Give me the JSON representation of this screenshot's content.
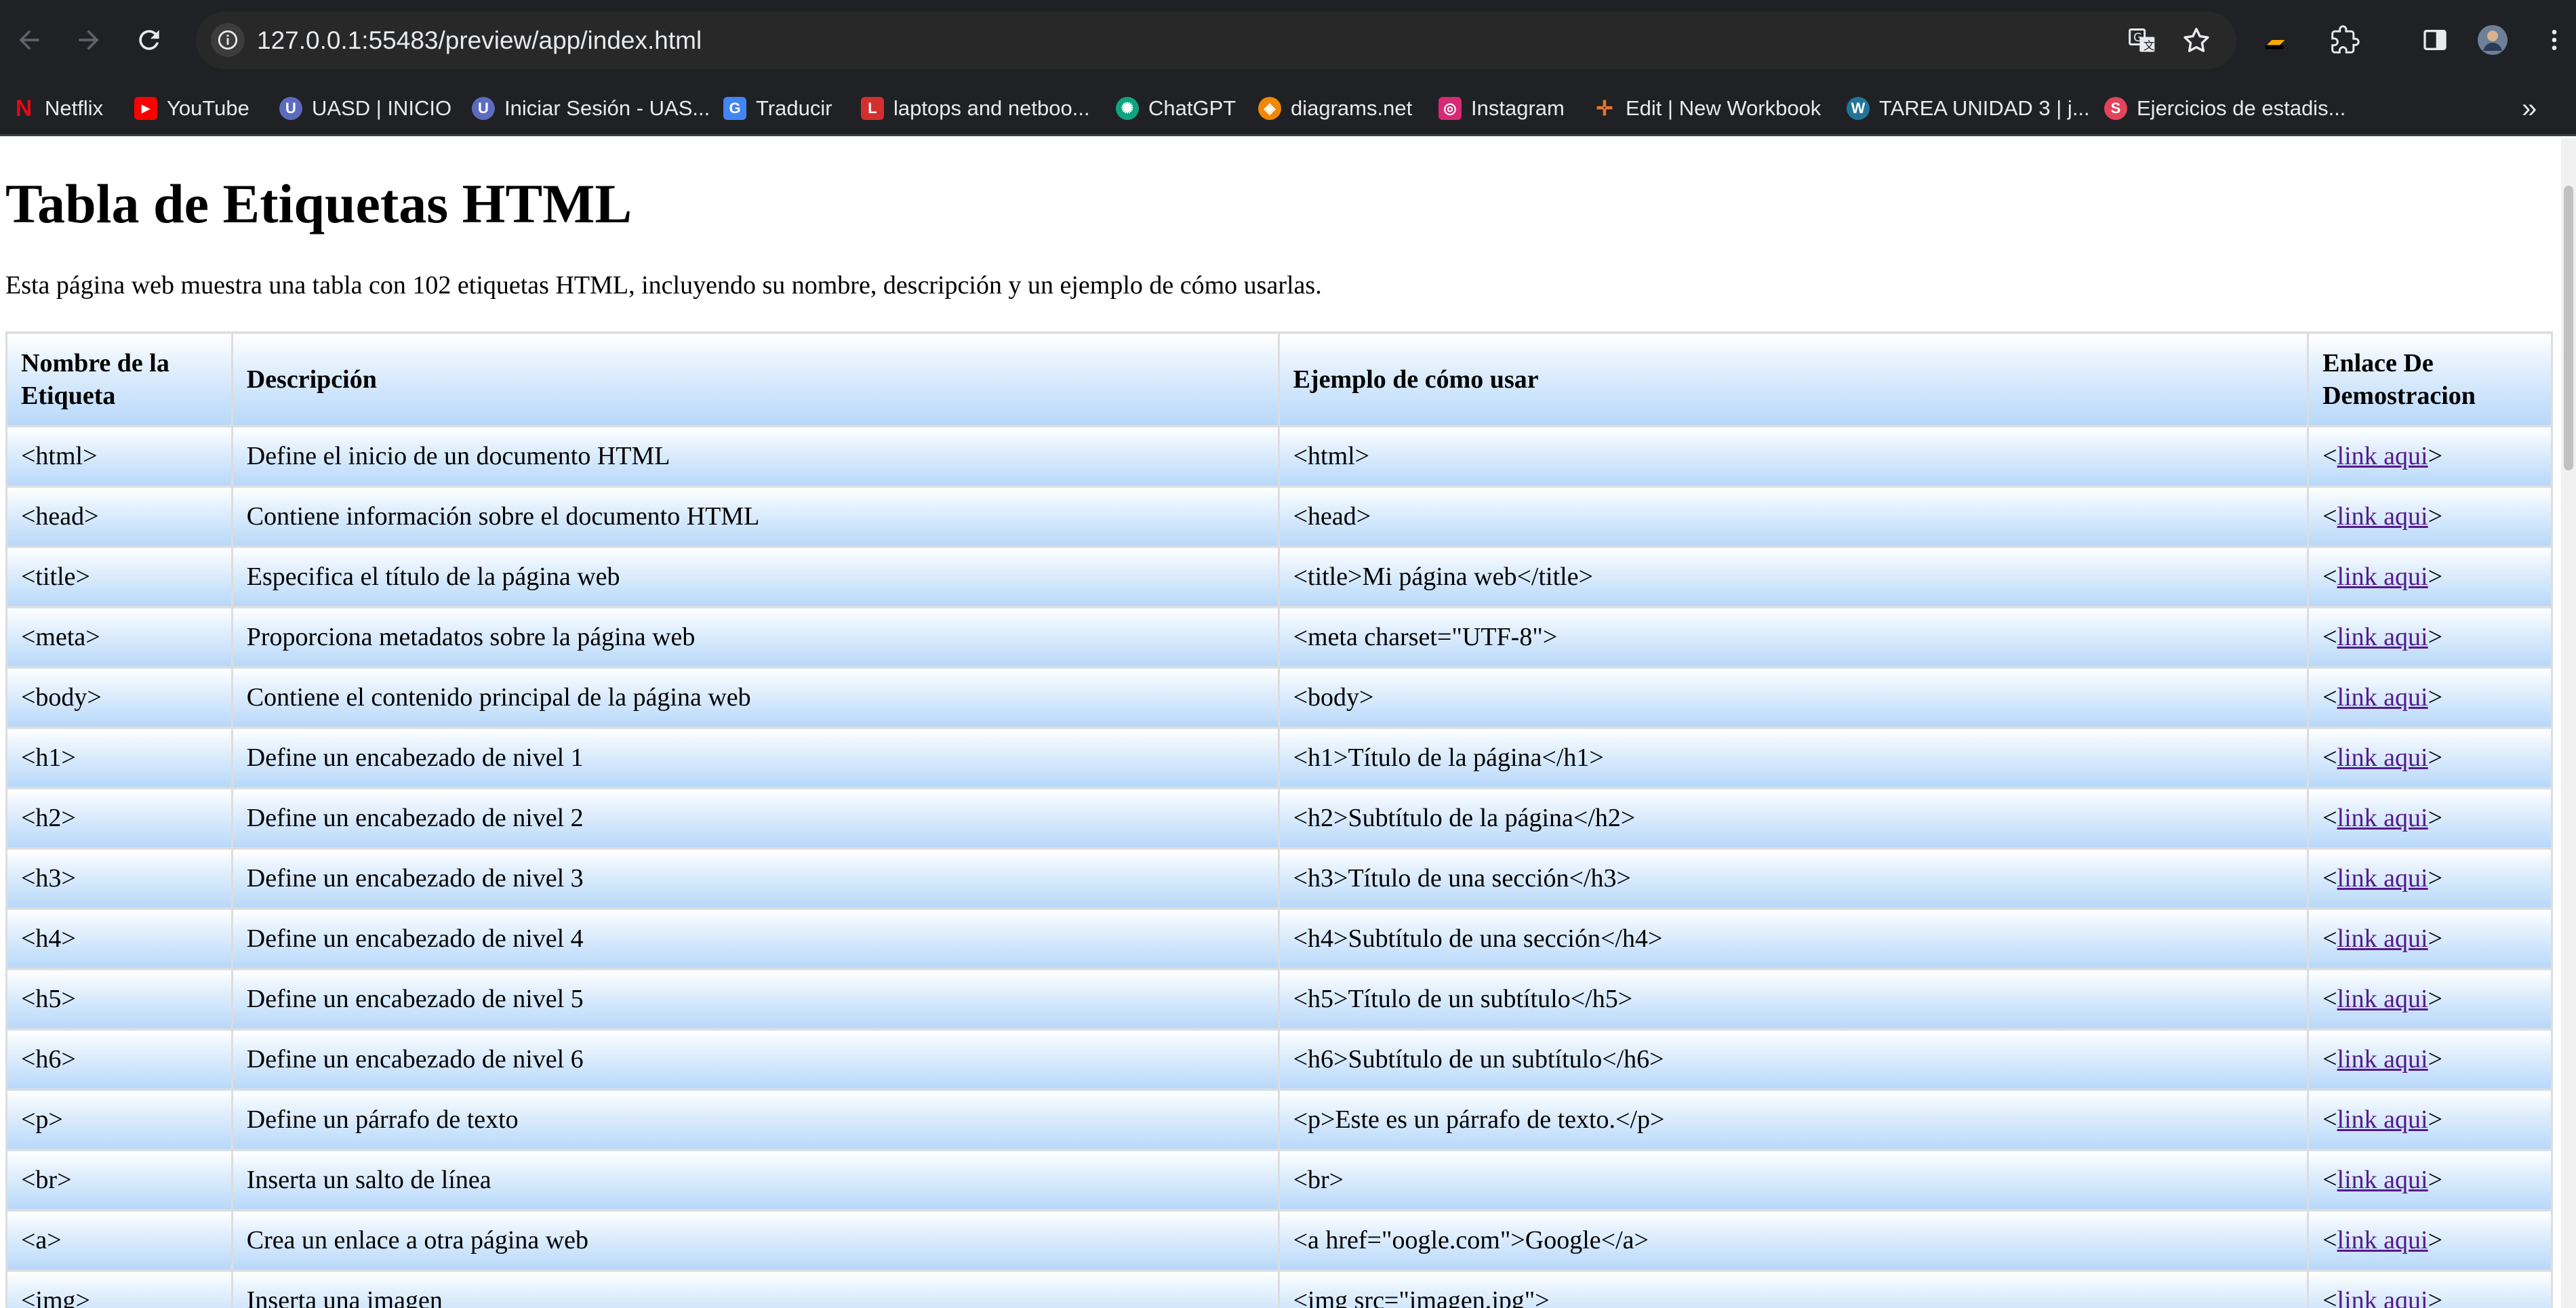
{
  "browser": {
    "url": "127.0.0.1:55483/preview/app/index.html",
    "bookmarks": [
      {
        "label": "Netflix",
        "icon": "netflix-icon",
        "color": "#e50914",
        "glyph": "N"
      },
      {
        "label": "YouTube",
        "icon": "youtube-icon",
        "color": "#ff0000",
        "glyph": "▶"
      },
      {
        "label": "UASD | INICIO",
        "icon": "uasd-icon",
        "color": "#5c6bc0",
        "glyph": "U"
      },
      {
        "label": "Iniciar Sesión - UAS...",
        "icon": "uasd-login-icon",
        "color": "#5c6bc0",
        "glyph": "U"
      },
      {
        "label": "Traducir",
        "icon": "translate-icon",
        "color": "#4285f4",
        "glyph": "G"
      },
      {
        "label": "laptops and netboo...",
        "icon": "laptops-icon",
        "color": "#d32f2f",
        "glyph": "L"
      },
      {
        "label": "ChatGPT",
        "icon": "chatgpt-icon",
        "color": "#10a37f",
        "glyph": "✺"
      },
      {
        "label": "diagrams.net",
        "icon": "diagrams-icon",
        "color": "#f08705",
        "glyph": "◈"
      },
      {
        "label": "Instagram",
        "icon": "instagram-icon",
        "color": "#d62976",
        "glyph": "◎"
      },
      {
        "label": "Edit | New Workbook",
        "icon": "tableau-icon",
        "color": "#e8762d",
        "glyph": "✛"
      },
      {
        "label": "TAREA UNIDAD 3 | j...",
        "icon": "wordpress-icon",
        "color": "#21759b",
        "glyph": "W"
      },
      {
        "label": "Ejercicios de estadis...",
        "icon": "ejercicios-icon",
        "color": "#e2445c",
        "glyph": "S"
      }
    ]
  },
  "page": {
    "title": "Tabla de Etiquetas HTML",
    "intro": "Esta página web muestra una tabla con 102 etiquetas HTML, incluyendo su nombre, descripción y un ejemplo de cómo usarlas.",
    "headers": [
      "Nombre de la Etiqueta",
      "Descripción",
      "Ejemplo de cómo usar",
      "Enlace De Demostracion"
    ],
    "link_prefix": "<",
    "link_text": "link aqui",
    "link_suffix": ">",
    "rows": [
      {
        "tag": "<html>",
        "desc": "Define el inicio de un documento HTML",
        "example": "<html>"
      },
      {
        "tag": "<head>",
        "desc": "Contiene información sobre el documento HTML",
        "example": "<head>"
      },
      {
        "tag": "<title>",
        "desc": "Especifica el título de la página web",
        "example": "<title>Mi página web</title>"
      },
      {
        "tag": "<meta>",
        "desc": "Proporciona metadatos sobre la página web",
        "example": "<meta charset=\"UTF-8\">"
      },
      {
        "tag": "<body>",
        "desc": "Contiene el contenido principal de la página web",
        "example": "<body>"
      },
      {
        "tag": "<h1>",
        "desc": "Define un encabezado de nivel 1",
        "example": "<h1>Título de la página</h1>"
      },
      {
        "tag": "<h2>",
        "desc": "Define un encabezado de nivel 2",
        "example": "<h2>Subtítulo de la página</h2>"
      },
      {
        "tag": "<h3>",
        "desc": "Define un encabezado de nivel 3",
        "example": "<h3>Título de una sección</h3>"
      },
      {
        "tag": "<h4>",
        "desc": "Define un encabezado de nivel 4",
        "example": "<h4>Subtítulo de una sección</h4>"
      },
      {
        "tag": "<h5>",
        "desc": "Define un encabezado de nivel 5",
        "example": "<h5>Título de un subtítulo</h5>"
      },
      {
        "tag": "<h6>",
        "desc": "Define un encabezado de nivel 6",
        "example": "<h6>Subtítulo de un subtítulo</h6>"
      },
      {
        "tag": "<p>",
        "desc": "Define un párrafo de texto",
        "example": "<p>Este es un párrafo de texto.</p>"
      },
      {
        "tag": "<br>",
        "desc": "Inserta un salto de línea",
        "example": "<br>"
      },
      {
        "tag": "<a>",
        "desc": "Crea un enlace a otra página web",
        "example": "<a href=\"oogle.com\">Google</a>"
      },
      {
        "tag": "<img>",
        "desc": "Inserta una imagen",
        "example": "<img src=\"imagen.jpg\">"
      }
    ]
  }
}
